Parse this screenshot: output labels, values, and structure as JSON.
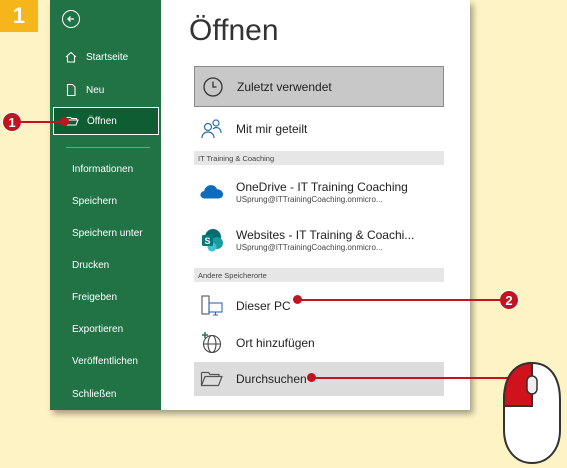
{
  "step": "1",
  "sidebar": {
    "items": [
      {
        "label": "Startseite",
        "icon": "home-icon"
      },
      {
        "label": "Neu",
        "icon": "new-document-icon"
      },
      {
        "label": "Öffnen",
        "icon": "open-folder-icon"
      },
      {
        "label": "Informationen"
      },
      {
        "label": "Speichern"
      },
      {
        "label": "Speichern unter"
      },
      {
        "label": "Drucken"
      },
      {
        "label": "Freigeben"
      },
      {
        "label": "Exportieren"
      },
      {
        "label": "Veröffentlichen"
      },
      {
        "label": "Schließen"
      }
    ]
  },
  "main": {
    "title": "Öffnen",
    "recent": "Zuletzt verwendet",
    "shared": "Mit mir geteilt",
    "section1": "IT Training & Coaching",
    "onedrive": {
      "title": "OneDrive - IT Training  Coaching",
      "sub": "USprung@ITTrainingCoaching.onmicro..."
    },
    "sites": {
      "title": "Websites - IT Training & Coachi...",
      "sub": "USprung@ITTrainingCoaching.onmicro..."
    },
    "section2": "Andere Speicherorte",
    "thispc": "Dieser PC",
    "addplace": "Ort hinzufügen",
    "browse": "Durchsuchen"
  },
  "callouts": {
    "c1": "1",
    "c2": "2"
  },
  "colors": {
    "sidebar": "#217346",
    "accent": "#c0141f",
    "badge": "#f5b51b",
    "background": "#fdf3c4"
  }
}
